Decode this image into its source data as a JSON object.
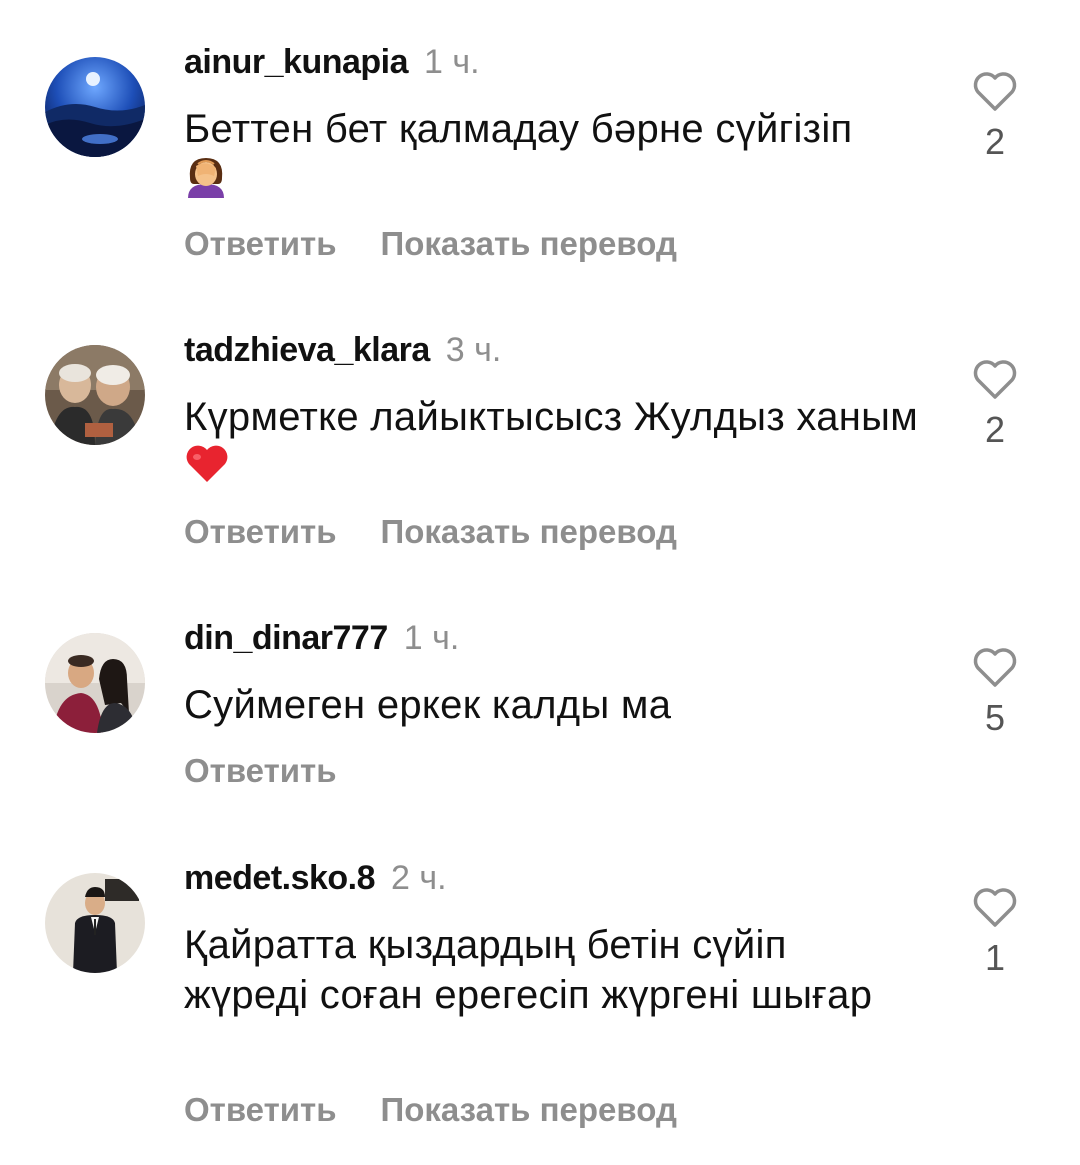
{
  "comments": [
    {
      "username": "ainur_kunapia",
      "time": "1 ч.",
      "text": "Беттен бет қалмадау бәрне сүйгізіп",
      "emoji": "woman-facepalming",
      "reply_label": "Ответить",
      "translate_label": "Показать перевод",
      "likes": "2",
      "avatar": "night-landscape"
    },
    {
      "username": "tadzhieva_klara",
      "time": "3 ч.",
      "text": "Күрметке лайыктысысз Жулдыз ханым",
      "emoji": "red-heart",
      "reply_label": "Ответить",
      "translate_label": "Показать перевод",
      "likes": "2",
      "avatar": "elderly-couple-photo"
    },
    {
      "username": "din_dinar777",
      "time": "1 ч.",
      "text": "Суймеген еркек калды ма",
      "reply_label": "Ответить",
      "likes": "5",
      "avatar": "couple-selfie"
    },
    {
      "username": "medet.sko.8",
      "time": "2 ч.",
      "text": "Қайратта қыздардың бетін сүйіп жүреді соған ерегесіп жүргені шығар",
      "reply_label": "Ответить",
      "translate_label": "Показать перевод",
      "likes": "1",
      "avatar": "man-in-suit"
    }
  ],
  "icons": {
    "like": "heart-outline-icon"
  },
  "colors": {
    "text": "#111111",
    "secondary": "#8e8e8e",
    "like_count": "#555555",
    "heart_stroke": "#8e8e8e",
    "heart_emoji": "#e8242f"
  }
}
